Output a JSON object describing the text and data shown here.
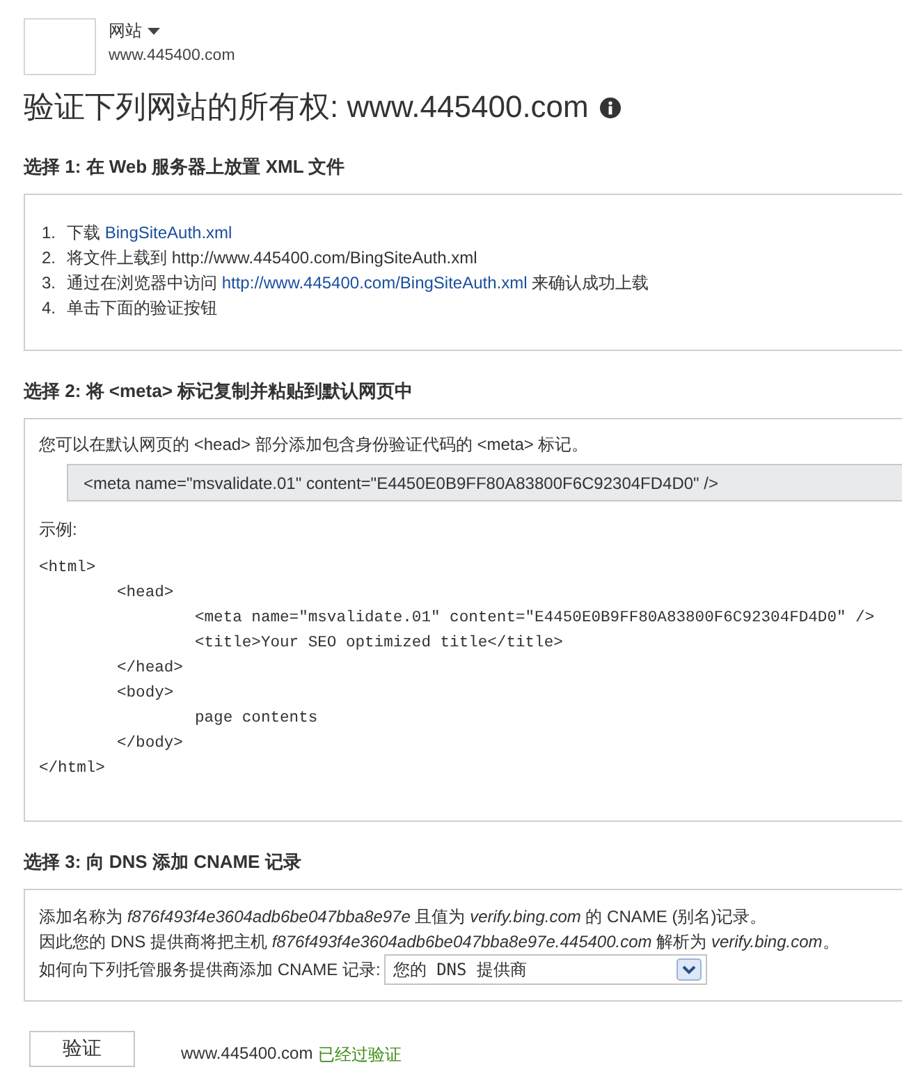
{
  "header": {
    "site_menu": "网站",
    "site_url": "www.445400.com"
  },
  "title": "验证下列网站的所有权: www.445400.com",
  "options": [
    {
      "kind": "file",
      "heading": "选择 1: 在 Web 服务器上放置 XML 文件",
      "steps": [
        {
          "number": "1.",
          "parts": [
            {
              "kind": "text",
              "text": "下载"
            },
            {
              "kind": "link",
              "text": "BingSiteAuth.xml"
            }
          ]
        },
        {
          "number": "2.",
          "parts": [
            {
              "kind": "text",
              "text": "将文件上载到 http://www.445400.com/BingSiteAuth.xml"
            }
          ]
        },
        {
          "number": "3.",
          "parts": [
            {
              "kind": "text",
              "text": "通过在浏览器中访问"
            },
            {
              "kind": "link",
              "text": "http://www.445400.com/BingSiteAuth.xml"
            },
            {
              "kind": "text",
              "text": "来确认成功上载"
            }
          ]
        },
        {
          "number": "4.",
          "parts": [
            {
              "kind": "text",
              "text": "单击下面的验证按钮"
            }
          ]
        }
      ]
    },
    {
      "kind": "meta",
      "heading": "选择 2: 将 <meta> 标记复制并粘贴到默认网页中",
      "intro": "您可以在默认网页的 <head> 部分添加包含身份验证代码的 <meta> 标记。",
      "meta_tag": "<meta name=\"msvalidate.01\" content=\"E4450E0B9FF80A83800F6C92304FD4D0\" />",
      "example_label": "示例:",
      "example_code": [
        {
          "text": "<html>",
          "children": [
            {
              "text": "<head>",
              "children": [
                {
                  "text": "<meta name=\"msvalidate.01\" content=\"E4450E0B9FF80A83800F6C92304FD4D0\" />"
                },
                {
                  "text": "<title>Your SEO optimized title</title>"
                }
              ]
            },
            {
              "text": "</head>"
            },
            {
              "text": "<body>",
              "children": [
                {
                  "text": "page contents"
                }
              ]
            },
            {
              "text": "</body>"
            }
          ]
        },
        {
          "text": "</html>"
        }
      ]
    },
    {
      "kind": "dns",
      "heading": "选择 3: 向 DNS 添加 CNAME 记录",
      "lines": [
        "添加名称为 *f876f493f4e3604adb6be047bba8e97e* 且值为 *verify.bing.com* 的 CNAME (别名)记录。",
        "因此您的 DNS 提供商将把主机 *f876f493f4e3604adb6be047bba8e97e.445400.com* 解析为 *verify.bing.com*。"
      ],
      "provider_label": "如何向下列托管服务提供商添加 CNAME 记录:",
      "provider_select": {
        "value": "您的 DNS 提供商"
      }
    }
  ],
  "actions": {
    "verify_button": "验证",
    "site": "www.445400.com",
    "status": "已经过验证"
  }
}
